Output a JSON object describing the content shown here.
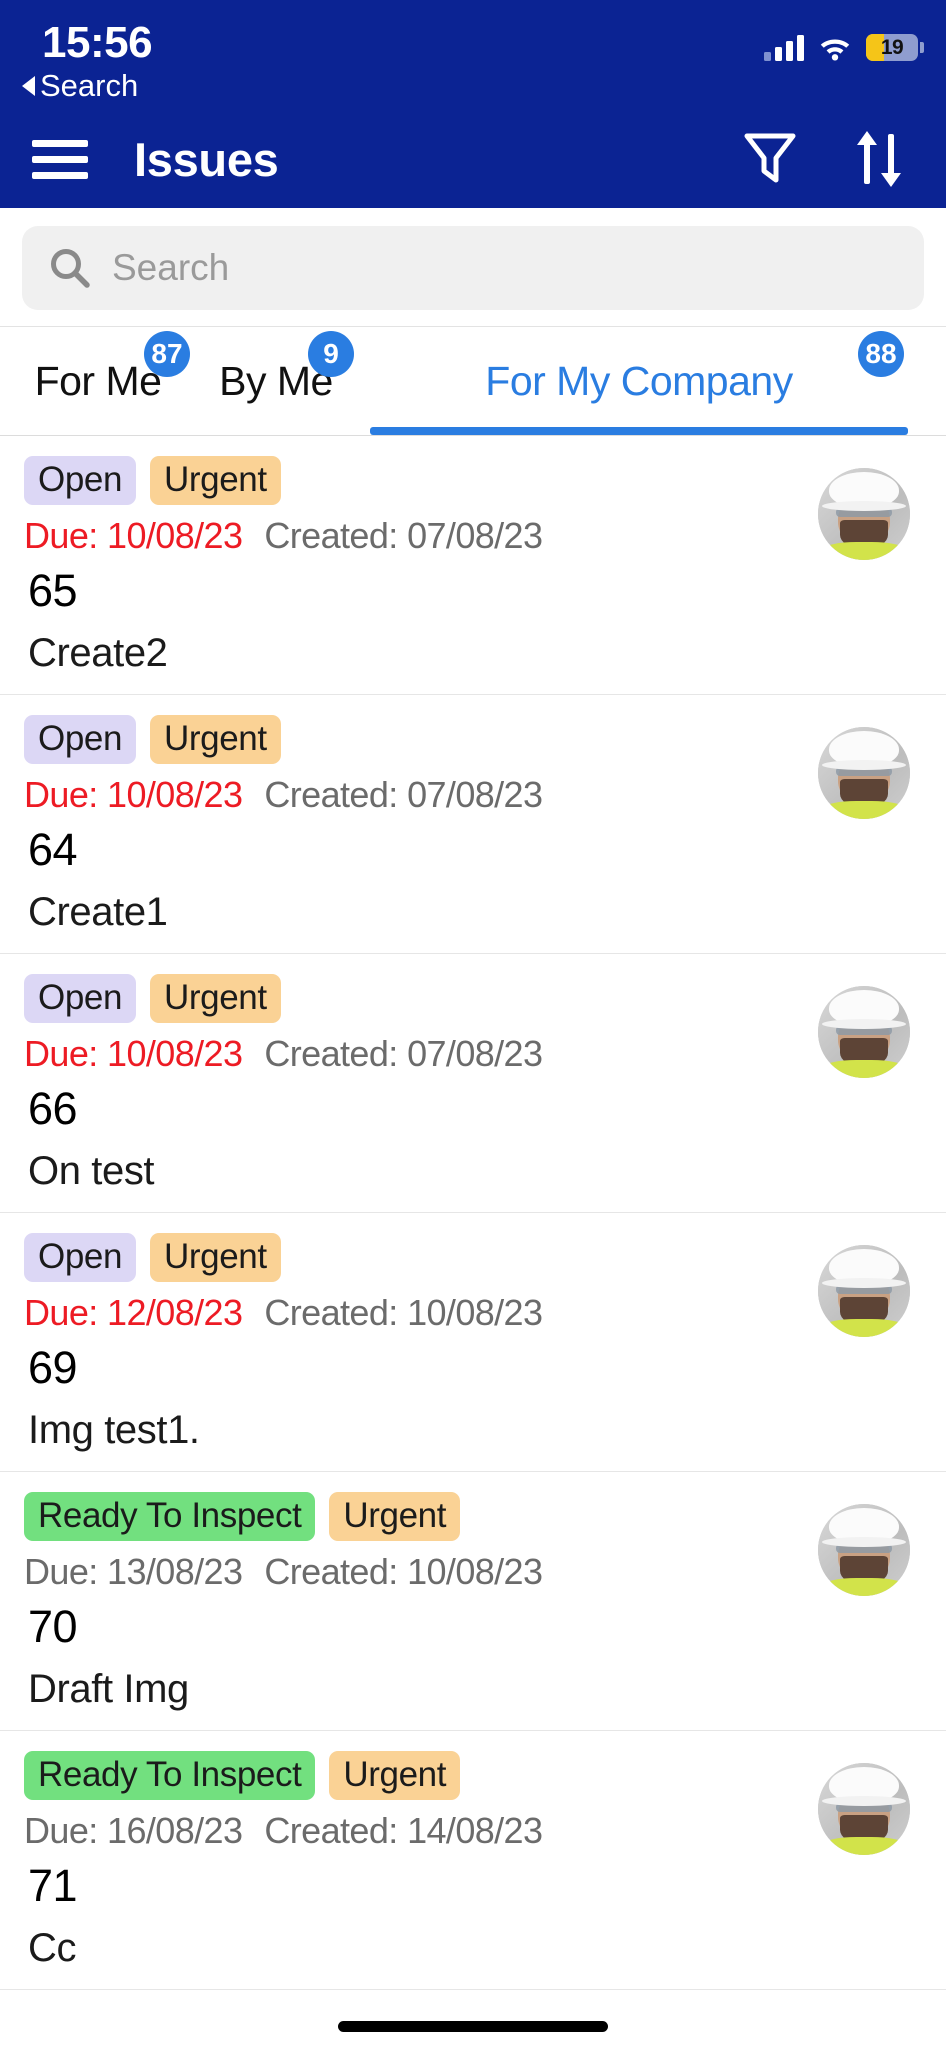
{
  "status_bar": {
    "time": "15:56",
    "back_label": "Search",
    "battery_level": "19",
    "battery_low_power_color": "#f5c518"
  },
  "nav": {
    "title": "Issues",
    "menu_icon": "hamburger-icon",
    "filter_icon": "filter-funnel-icon",
    "sort_icon": "sort-arrows-icon",
    "background_color": "#0b2393"
  },
  "search": {
    "placeholder": "Search",
    "value": "",
    "icon": "search-icon"
  },
  "tabs": [
    {
      "label": "For Me",
      "badge": "87",
      "active": false
    },
    {
      "label": "By Me",
      "badge": "9",
      "active": false
    },
    {
      "label": "For My Company",
      "badge": "88",
      "active": true
    }
  ],
  "accent_color": "#2a7de1",
  "issues": [
    {
      "status": "Open",
      "status_kind": "open",
      "priority": "Urgent",
      "due_label": "Due: 10/08/23",
      "due_overdue": true,
      "created_label": "Created: 07/08/23",
      "id": "65",
      "title": "Create2"
    },
    {
      "status": "Open",
      "status_kind": "open",
      "priority": "Urgent",
      "due_label": "Due: 10/08/23",
      "due_overdue": true,
      "created_label": "Created: 07/08/23",
      "id": "64",
      "title": "Create1"
    },
    {
      "status": "Open",
      "status_kind": "open",
      "priority": "Urgent",
      "due_label": "Due: 10/08/23",
      "due_overdue": true,
      "created_label": "Created: 07/08/23",
      "id": "66",
      "title": "On test"
    },
    {
      "status": "Open",
      "status_kind": "open",
      "priority": "Urgent",
      "due_label": "Due: 12/08/23",
      "due_overdue": true,
      "created_label": "Created: 10/08/23",
      "id": "69",
      "title": "Img test1."
    },
    {
      "status": "Ready To Inspect",
      "status_kind": "ready",
      "priority": "Urgent",
      "due_label": "Due: 13/08/23",
      "due_overdue": false,
      "created_label": "Created: 10/08/23",
      "id": "70",
      "title": "Draft Img"
    },
    {
      "status": "Ready To Inspect",
      "status_kind": "ready",
      "priority": "Urgent",
      "due_label": "Due: 16/08/23",
      "due_overdue": false,
      "created_label": "Created: 14/08/23",
      "id": "71",
      "title": "Cc"
    }
  ],
  "colors": {
    "status_open_bg": "#dcd7f5",
    "status_ready_bg": "#72e07f",
    "priority_bg": "#fad295",
    "overdue_text": "#ed1b24",
    "muted_text": "#6b6b6b"
  }
}
